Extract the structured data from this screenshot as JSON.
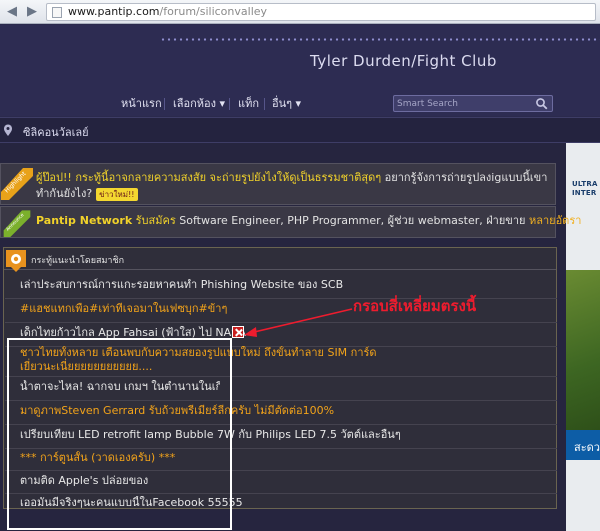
{
  "browser": {
    "url_host": "www.pantip.com",
    "url_path": "/forum/siliconvalley"
  },
  "header": {
    "club_title": "Tyler Durden/Fight Club"
  },
  "nav": {
    "items": [
      {
        "label": "หน้าแรก"
      },
      {
        "label": "เลือกห้อง ▾"
      },
      {
        "label": "แท็ก"
      },
      {
        "label": "อื่นๆ ▾"
      }
    ],
    "search_placeholder": "Smart Search"
  },
  "breadcrumb": {
    "label": "ซิลิคอนวัลเลย์"
  },
  "highlight": {
    "ribbon": "Highlight",
    "title": "ผู้ป๊อป!! กระทู้นี้อาจกลายความสงสัย จะถ่ายรูปยังไงให้ดูเป็นธรรมชาติสุดๆ",
    "desc": " อยากรู้จังการถ่ายรูปลงigแบบนี้เขาทำกันยังไง?",
    "badge": "ข่าวใหม่!!"
  },
  "announce": {
    "ribbon": "Announce",
    "brand": "Pantip Network",
    "job1": " รับสมัคร",
    "body": " Software Engineer, PHP Programmer, ผู้ช่วย webmaster, ฝ่ายขาย ",
    "tail": "หลายอัตรา"
  },
  "recommended": {
    "heading": "กระทู้แนะนำโดยสมาชิก",
    "topics": [
      {
        "title": "เล่าประสบการณ์การแกะรอยหาคนทำ Phishing Website ของ SCB",
        "style": "w"
      },
      {
        "title": "#แฮชแทกเพื่อ#เท่าที่เจอมาในเฟซบุก#ข้าๆ",
        "style": "o"
      },
      {
        "title": "เด็กไทยก้าวไกล App Fahsai (ฟ้าใส) ไป NASA",
        "style": "w"
      },
      {
        "title": "ชาวไทยทั้งหลาย เตือนพบกับความสยองรูปแบบใหม่ ถึงขั้นทำลาย SIM การ์ด เยี่ยวนะเนี่ยยยยยยยยยยย....",
        "style": "o"
      },
      {
        "title": "น้ำตาจะไหล! ฉากจบ เกมฯ ในตำนานในเกียรติ",
        "style": "w"
      },
      {
        "title": "มาดูภาพSteven Gerrard รับถ้วยพรีเมียร์ลีกครับ ไม่มีตัดต่อ100%",
        "style": "o"
      },
      {
        "title": "เปรียบเทียบ LED retrofit lamp Bubble 7W กับ Philips LED 7.5 วัตต์และอื่นๆ",
        "style": "w"
      },
      {
        "title": "*** การ์ตูนสั้น (วาดเองครับ) ***",
        "style": "o"
      },
      {
        "title": "ตามติด Apple's ปล่อยของ",
        "style": "w"
      },
      {
        "title": "เออมันมีจริงๆนะคนแบบนี้ในFacebook 55555",
        "style": "w"
      }
    ]
  },
  "annotation": {
    "label": "กรอบสี่เหลี่ยมตรงนี้"
  },
  "side_ad": {
    "line1": "ULTRA",
    "line2": "INTER",
    "bar_text": "สะดว"
  },
  "colors": {
    "accent_yellow": "#f1d22a",
    "link_orange": "#f2a31a",
    "annotation_red": "#ee1c2e",
    "page_bg": "#2b2a4d"
  }
}
